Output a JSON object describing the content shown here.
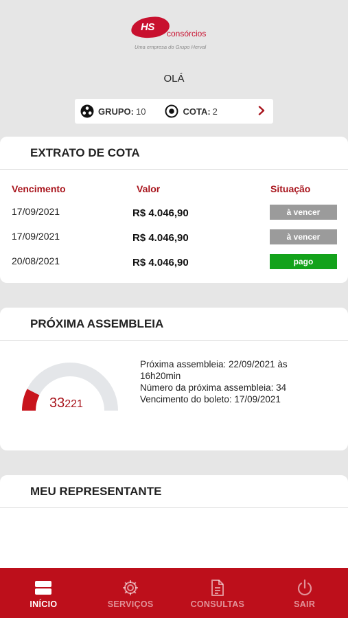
{
  "brand": {
    "logo_hs": "HS",
    "logo_name": "consórcios",
    "tagline": "Uma empresa do Grupo Herval",
    "color": "#c8102e"
  },
  "greeting": "OLÁ",
  "cota_bar": {
    "grupo_label": "GRUPO:",
    "grupo_value": "10",
    "cota_label": "COTA:",
    "cota_value": "2"
  },
  "extrato": {
    "title": "EXTRATO DE COTA",
    "headers": {
      "vencimento": "Vencimento",
      "valor": "Valor",
      "situacao": "Situação"
    },
    "rows": [
      {
        "date": "17/09/2021",
        "value": "R$ 4.046,90",
        "status": "à vencer",
        "status_color": "#9b9b9b"
      },
      {
        "date": "17/09/2021",
        "value": "R$ 4.046,90",
        "status": "à vencer",
        "status_color": "#9b9b9b"
      },
      {
        "date": "20/08/2021",
        "value": "R$ 4.046,90",
        "status": "pago",
        "status_color": "#13a21b"
      }
    ]
  },
  "assembleia": {
    "title": "PRÓXIMA ASSEMBLEIA",
    "gauge_value": "33",
    "gauge_total": "221",
    "gauge_fraction": 0.149,
    "line1": "Próxima assembleia: 22/09/2021 às",
    "line2": "16h20min",
    "line3": "Número da próxima assembleia: 34",
    "line4": "Vencimento do boleto: 17/09/2021"
  },
  "representante": {
    "title": "MEU REPRESENTANTE"
  },
  "tabbar": {
    "color": "#bd0f1b",
    "tabs": [
      {
        "label": "INÍCIO",
        "icon": "home-icon",
        "active": true
      },
      {
        "label": "SERVIÇOS",
        "icon": "gear-icon",
        "active": false
      },
      {
        "label": "CONSULTAS",
        "icon": "document-icon",
        "active": false
      },
      {
        "label": "SAIR",
        "icon": "power-icon",
        "active": false
      }
    ]
  }
}
